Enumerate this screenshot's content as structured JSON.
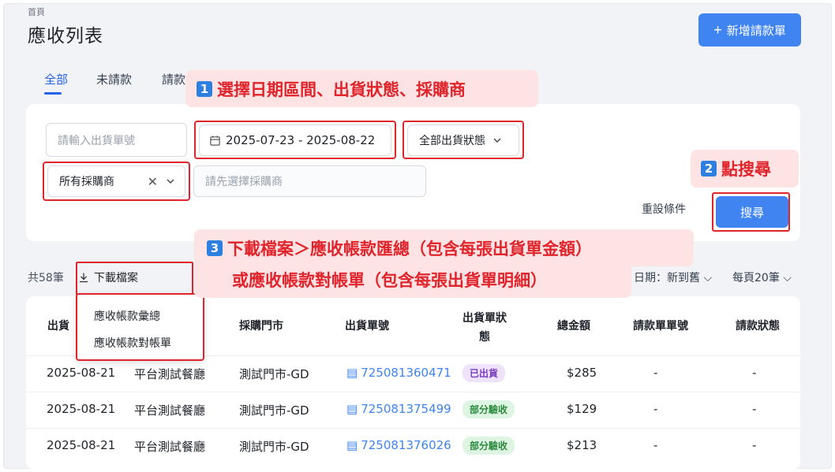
{
  "breadcrumb": "首頁",
  "page_title": "應收列表",
  "new_button": "新增請款單",
  "tabs": [
    "全部",
    "未請款",
    "請款"
  ],
  "callouts": {
    "c1": {
      "num": "1",
      "text": "選擇日期區間、出貨狀態、採購商"
    },
    "c2": {
      "num": "2",
      "text": "點搜尋"
    },
    "c3": {
      "num": "3",
      "line1": "下載檔案＞應收帳款匯總（包含每張出貨單金額）",
      "line2": "或應收帳款對帳單（包含每張出貨單明細）"
    }
  },
  "filters": {
    "order_placeholder": "請輸入出貨單號",
    "date_range": "2025-07-23 - 2025-08-22",
    "ship_status": "全部出貨狀態",
    "buyer": "所有採購商",
    "store_placeholder": "請先選擇採購商",
    "reset": "重設條件",
    "search": "搜尋"
  },
  "list_bar": {
    "count": "共58筆",
    "download": "下載檔案",
    "sort": "日期：新到舊",
    "page_size": "每頁20筆"
  },
  "download_menu": [
    "應收帳款彙總",
    "應收帳款對帳單"
  ],
  "table": {
    "headers": {
      "date": "出貨",
      "buyer_store": "採購門市",
      "order_no": "出貨單號",
      "status_l1": "出貨單狀",
      "status_l2": "態",
      "total": "總金額",
      "invoice_no": "請款單單號",
      "invoice_status": "請款狀態"
    },
    "rows": [
      {
        "date": "2025-08-21",
        "buyer": "平台測試餐廳",
        "store": "測試門市-GD",
        "order": "725081360471",
        "status": "已出貨",
        "total": "$285",
        "invoice_no": "-",
        "invoice_status": "-"
      },
      {
        "date": "2025-08-21",
        "buyer": "平台測試餐廳",
        "store": "測試門市-GD",
        "order": "725081375499",
        "status": "部分驗收",
        "total": "$129",
        "invoice_no": "-",
        "invoice_status": "-"
      },
      {
        "date": "2025-08-21",
        "buyer": "平台測試餐廳",
        "store": "測試門市-GD",
        "order": "725081376026",
        "status": "部分驗收",
        "total": "$213",
        "invoice_no": "-",
        "invoice_status": "-"
      }
    ]
  },
  "colors": {
    "primary": "#3f84f0",
    "callout_text": "#e0242c",
    "callout_bg": "#fde3e3"
  }
}
